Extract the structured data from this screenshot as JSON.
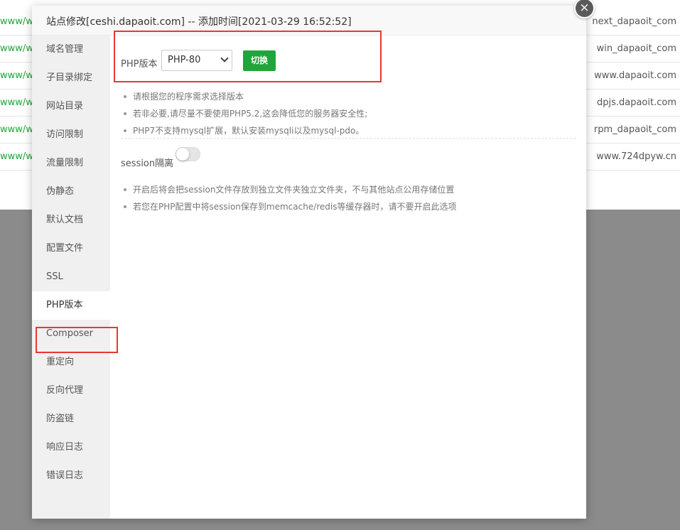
{
  "background": {
    "rows": [
      {
        "left": "www/ww",
        "right": "next_dapaoit_com"
      },
      {
        "left": "www/ww",
        "right": "win_dapaoit_com"
      },
      {
        "left": "www/ww",
        "right": "www.dapaoit.com"
      },
      {
        "left": "www/ww",
        "right": "dpjs.dapaoit.com"
      },
      {
        "left": "www/ww",
        "right": "rpm_dapaoit_com"
      },
      {
        "left": "www/ww",
        "right": "www.724dpyw.cn"
      }
    ]
  },
  "modal": {
    "title": "站点修改[ceshi.dapaoit.com] -- 添加时间[2021-03-29 16:52:52]",
    "close_icon": "×"
  },
  "sidebar": {
    "items": [
      {
        "label": "域名管理"
      },
      {
        "label": "子目录绑定"
      },
      {
        "label": "网站目录"
      },
      {
        "label": "访问限制"
      },
      {
        "label": "流量限制"
      },
      {
        "label": "伪静态"
      },
      {
        "label": "默认文档"
      },
      {
        "label": "配置文件"
      },
      {
        "label": "SSL"
      },
      {
        "label": "PHP版本"
      },
      {
        "label": "Composer"
      },
      {
        "label": "重定向"
      },
      {
        "label": "反向代理"
      },
      {
        "label": "防盗链"
      },
      {
        "label": "响应日志"
      },
      {
        "label": "错误日志"
      }
    ],
    "active_index": 9
  },
  "php": {
    "label": "PHP版本",
    "selected": "PHP-80",
    "switch_label": "切换",
    "tips": [
      "请根据您的程序需求选择版本",
      "若非必要,请尽量不要使用PHP5.2,这会降低您的服务器安全性;",
      "PHP7不支持mysql扩展，默认安装mysqli以及mysql-pdo。"
    ]
  },
  "session": {
    "label": "session隔离",
    "enabled": false,
    "tips": [
      "开启后将会把session文件存放到独立文件夹独立文件夹，不与其他站点公用存储位置",
      "若您在PHP配置中将session保存到memcache/redis等缓存器时，请不要开启此选项"
    ]
  },
  "colors": {
    "accent": "#20a53a",
    "highlight_box": "#e53935"
  }
}
